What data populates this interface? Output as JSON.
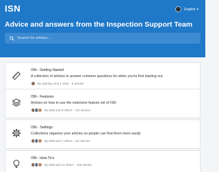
{
  "header": {
    "logo": "ISN",
    "language": "English",
    "headline": "Advice and answers from the Inspection Support Team",
    "search_placeholder": "Search for articles..."
  },
  "collections": [
    {
      "icon": "ruler-icon",
      "title": "ISN - Getting Started",
      "description": "A collection of articles to answer common questions for when you're first starting out.",
      "meta": "By Quinkey and 1 other  ·  8 articles"
    },
    {
      "icon": "layers-icon",
      "title": "ISN - Features",
      "description": "Articles on how to use the extensive feature set of ISN",
      "meta": "By Matt and 8 others  ·  130 articles"
    },
    {
      "icon": "gear-icon",
      "title": "ISN - Settings",
      "description": "Collections organize your articles so people can find them more easily",
      "meta": "By Matt and 7 others  ·  111 articles"
    },
    {
      "icon": "lightbulb-icon",
      "title": "ISN - How To's",
      "description": "",
      "meta": "By Matt and 10 others  ·  108 articles"
    }
  ]
}
